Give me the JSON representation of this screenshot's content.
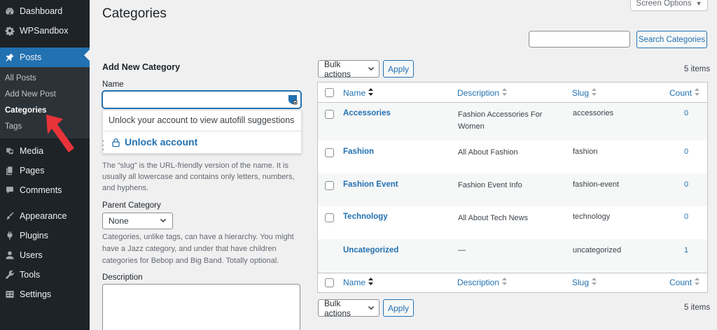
{
  "sidebar": {
    "items_top": [
      {
        "label": "Dashboard",
        "icon": "dashboard-icon"
      },
      {
        "label": "WPSandbox",
        "icon": "gear-icon"
      },
      {
        "label": "Posts",
        "icon": "pin-icon"
      }
    ],
    "submenu": [
      "All Posts",
      "Add New Post",
      "Categories",
      "Tags"
    ],
    "items_bottom": [
      {
        "label": "Media",
        "icon": "media-icon"
      },
      {
        "label": "Pages",
        "icon": "pages-icon"
      },
      {
        "label": "Comments",
        "icon": "comment-icon"
      },
      {
        "label": "Appearance",
        "icon": "brush-icon"
      },
      {
        "label": "Plugins",
        "icon": "plugin-icon"
      },
      {
        "label": "Users",
        "icon": "user-icon"
      },
      {
        "label": "Tools",
        "icon": "wrench-icon"
      },
      {
        "label": "Settings",
        "icon": "settings-icon"
      }
    ]
  },
  "header": {
    "title": "Categories",
    "screen_options": "Screen Options"
  },
  "search": {
    "button_label": "Search Categories",
    "value": ""
  },
  "form": {
    "heading": "Add New Category",
    "name_label": "Name",
    "name_value": "",
    "autofill_message": "Unlock your account to view autofill suggestions",
    "unlock_label": "Unlock account",
    "slug_help": "The “slug” is the URL-friendly version of the name. It is usually all lowercase and contains only letters, numbers, and hyphens.",
    "parent_label": "Parent Category",
    "parent_value": "None",
    "parent_help": "Categories, unlike tags, can have a hierarchy. You might have a Jazz category, and under that have children categories for Bebop and Big Band. Totally optional.",
    "description_label": "Description"
  },
  "list": {
    "bulk_label": "Bulk actions",
    "apply_label": "Apply",
    "items_count": "5 items",
    "columns": {
      "name": "Name",
      "description": "Description",
      "slug": "Slug",
      "count": "Count"
    },
    "rows": [
      {
        "name": "Accessories",
        "description": "Fashion Accessories For Women",
        "slug": "accessories",
        "count": "0"
      },
      {
        "name": "Fashion",
        "description": "All About Fashion",
        "slug": "fashion",
        "count": "0"
      },
      {
        "name": "Fashion Event",
        "description": "Fashion Event Info",
        "slug": "fashion-event",
        "count": "0"
      },
      {
        "name": "Technology",
        "description": "All About Tech News",
        "slug": "technology",
        "count": "0"
      },
      {
        "name": "Uncategorized",
        "description": "—",
        "slug": "uncategorized",
        "count": "1"
      }
    ]
  },
  "colors": {
    "sidebar_bg": "#1d2327",
    "accent": "#2271b1",
    "annotation_arrow": "#e8323a"
  }
}
